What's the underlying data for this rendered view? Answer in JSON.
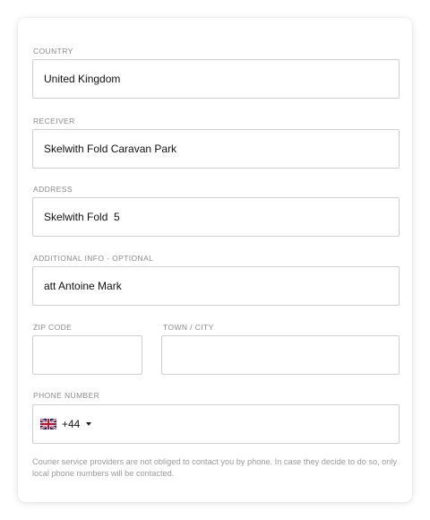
{
  "form": {
    "country": {
      "label": "COUNTRY",
      "value": "United Kingdom"
    },
    "receiver": {
      "label": "RECEIVER",
      "value": "Skelwith Fold Caravan Park"
    },
    "address": {
      "label": "ADDRESS",
      "value": "Skelwith Fold  5"
    },
    "additional_info": {
      "label": "ADDITIONAL INFO - OPTIONAL",
      "value": "att Antoine Mark"
    },
    "zip_code": {
      "label": "ZIP CODE",
      "value": ""
    },
    "town_city": {
      "label": "TOWN / CITY",
      "value": ""
    },
    "phone": {
      "label": "PHONE NUMBER",
      "country_flag_icon": "uk-flag-icon",
      "prefix": "+44",
      "value": ""
    },
    "note": "Courier service providers are not obliged to contact you by phone. In case they decide to do so, only local phone numbers will be contacted."
  },
  "colors": {
    "label_text": "#8a8a8a",
    "input_border": "#cfcfcf",
    "note_text": "#9a9a9a",
    "flag_blue": "#012169",
    "flag_red": "#C8102E"
  }
}
